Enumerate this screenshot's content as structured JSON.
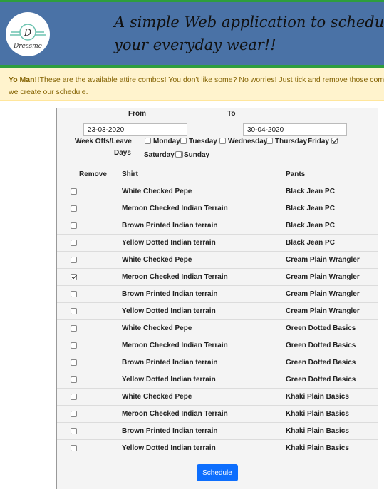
{
  "header": {
    "logo_letter": "D",
    "logo_text": "Dressme",
    "title": "A simple Web application to schedule your everyday wear!!",
    "bar_color": "#4a72a6",
    "accent_color": "#2e9e3e"
  },
  "alert": {
    "bold": "Yo Man!!",
    "text": "These are the available attire combos! You don't like some? No worries! Just tick and remove those combos before",
    "text2": "we create our schedule."
  },
  "form": {
    "from_label": "From",
    "to_label": "To",
    "from_value": "23-03-2020",
    "to_value": "30-04-2020",
    "weekoff_label_1": "Week Offs/Leave",
    "weekoff_label_2": "Days",
    "days": [
      {
        "label": "Monday",
        "checked": false
      },
      {
        "label": "Tuesday",
        "checked": false
      },
      {
        "label": "Wednesday",
        "checked": false
      },
      {
        "label": "Thursday",
        "checked": false
      },
      {
        "label": "Friday",
        "checked": true
      },
      {
        "label": "Saturday",
        "checked": true
      },
      {
        "label": "Sunday",
        "checked": false
      }
    ]
  },
  "table": {
    "headers": {
      "remove": "Remove",
      "shirt": "Shirt",
      "pants": "Pants"
    },
    "rows": [
      {
        "shirt": "White Checked Pepe",
        "pants": "Black Jean PC",
        "checked": false
      },
      {
        "shirt": "Meroon Checked Indian Terrain",
        "pants": "Black Jean PC",
        "checked": false
      },
      {
        "shirt": "Brown Printed Indian terrain",
        "pants": "Black Jean PC",
        "checked": false
      },
      {
        "shirt": "Yellow Dotted Indian terrain",
        "pants": "Black Jean PC",
        "checked": false
      },
      {
        "shirt": "White Checked Pepe",
        "pants": "Cream Plain Wrangler",
        "checked": false
      },
      {
        "shirt": "Meroon Checked Indian Terrain",
        "pants": "Cream Plain Wrangler",
        "checked": true
      },
      {
        "shirt": "Brown Printed Indian terrain",
        "pants": "Cream Plain Wrangler",
        "checked": false
      },
      {
        "shirt": "Yellow Dotted Indian terrain",
        "pants": "Cream Plain Wrangler",
        "checked": false
      },
      {
        "shirt": "White Checked Pepe",
        "pants": "Green Dotted Basics",
        "checked": false
      },
      {
        "shirt": "Meroon Checked Indian Terrain",
        "pants": "Green Dotted Basics",
        "checked": false
      },
      {
        "shirt": "Brown Printed Indian terrain",
        "pants": "Green Dotted Basics",
        "checked": false
      },
      {
        "shirt": "Yellow Dotted Indian terrain",
        "pants": "Green Dotted Basics",
        "checked": false
      },
      {
        "shirt": "White Checked Pepe",
        "pants": "Khaki Plain Basics",
        "checked": false
      },
      {
        "shirt": "Meroon Checked Indian Terrain",
        "pants": "Khaki Plain Basics",
        "checked": false
      },
      {
        "shirt": "Brown Printed Indian terrain",
        "pants": "Khaki Plain Basics",
        "checked": false
      },
      {
        "shirt": "Yellow Dotted Indian terrain",
        "pants": "Khaki Plain Basics",
        "checked": false
      }
    ]
  },
  "schedule_label": "Schedule"
}
